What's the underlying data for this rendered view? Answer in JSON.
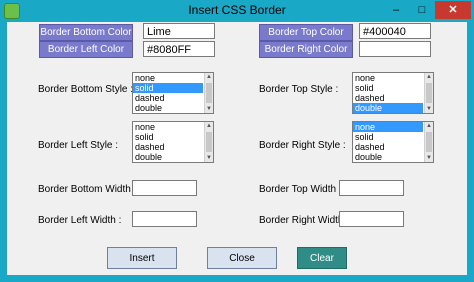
{
  "window": {
    "title": "Insert CSS Border",
    "minimize_glyph": "–",
    "maximize_glyph": "□",
    "close_glyph": "✕"
  },
  "colors": {
    "bottom_button": "Border Bottom Color",
    "bottom_value": "Lime",
    "top_button": "Border Top Color",
    "top_value": "#400040",
    "left_button": "Border Left Color",
    "left_value": "#8080FF",
    "right_button": "Border Right Color",
    "right_value": ""
  },
  "styles": {
    "bottom_label": "Border Bottom Style :",
    "top_label": "Border Top Style :",
    "left_label": "Border Left Style :",
    "right_label": "Border Right Style :",
    "options": [
      "none",
      "solid",
      "dashed",
      "double"
    ],
    "bottom_selected": "solid",
    "top_selected": "double",
    "left_selected": "",
    "right_selected": "none"
  },
  "widths": {
    "bottom_label": "Border Bottom Width :",
    "top_label": "Border Top Width :",
    "left_label": "Border Left Width :",
    "right_label": "Border Right Width :",
    "bottom_value": "",
    "top_value": "",
    "left_value": "",
    "right_value": ""
  },
  "buttons": {
    "insert": "Insert",
    "close": "Close",
    "clear": "Clear"
  },
  "accent_colors": {
    "title_bar": "#19a9c6",
    "color_button": "#7a7acc",
    "clear_button": "#2f8c86",
    "selection": "#3399ff"
  },
  "icons": {
    "scroll_up": "▲",
    "scroll_down": "▼"
  }
}
